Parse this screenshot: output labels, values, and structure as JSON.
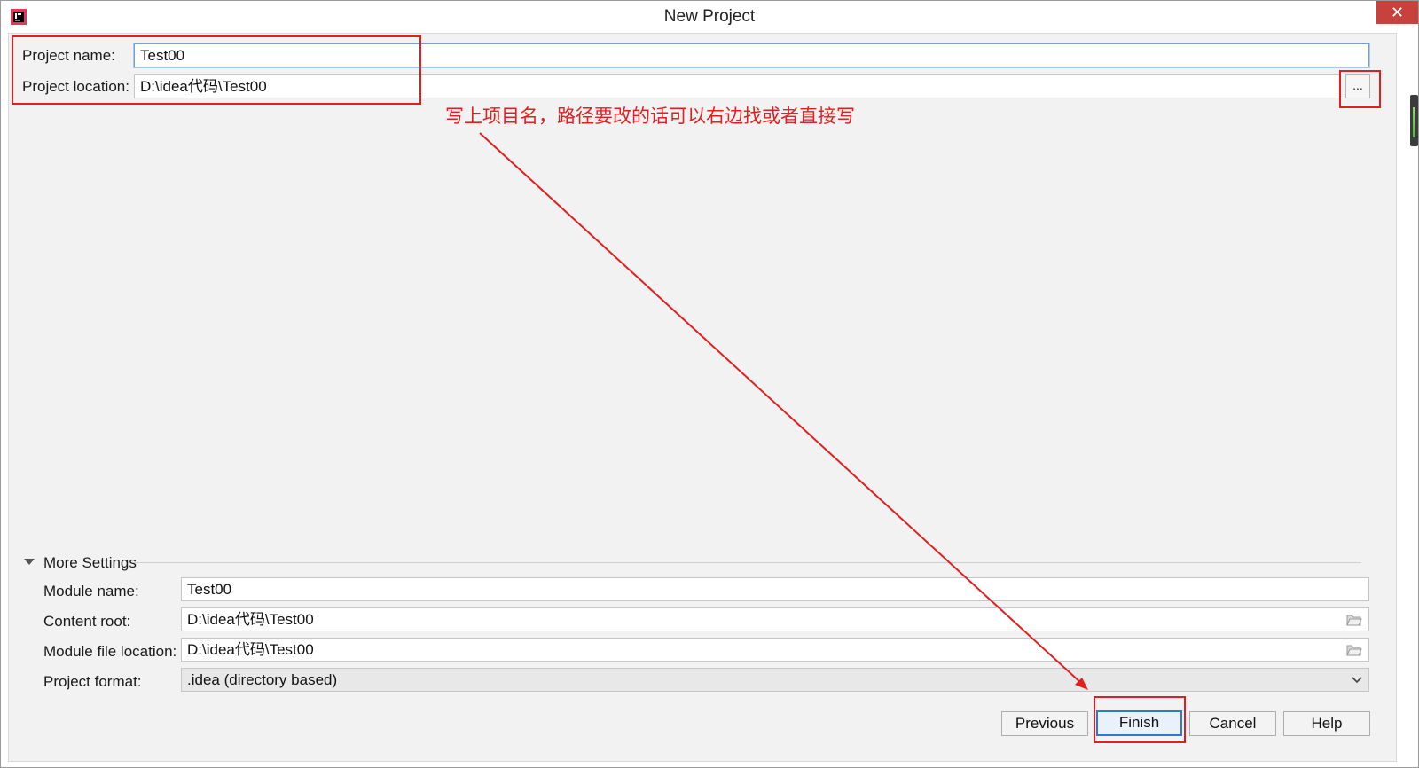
{
  "window": {
    "title": "New Project",
    "close_label": "✕",
    "app_icon": "intellij-idea-icon"
  },
  "project": {
    "name_label": "Project name:",
    "name_value": "Test00",
    "location_label": "Project location:",
    "location_value": "D:\\idea代码\\Test00",
    "browse_label": "..."
  },
  "more_settings": {
    "header": "More Settings",
    "module_name_label": "Module name:",
    "module_name_value": "Test00",
    "content_root_label": "Content root:",
    "content_root_value": "D:\\idea代码\\Test00",
    "module_file_label": "Module file location:",
    "module_file_value": "D:\\idea代码\\Test00",
    "format_label": "Project format:",
    "format_value": ".idea (directory based)"
  },
  "buttons": {
    "previous": "Previous",
    "finish": "Finish",
    "cancel": "Cancel",
    "help": "Help"
  },
  "annotation": {
    "text": "写上项目名，路径要改的话可以右边找或者直接写",
    "color": "#e21f1f"
  },
  "colors": {
    "dialog_bg": "#f2f2f2",
    "focus_blue": "#2a7ad6"
  }
}
